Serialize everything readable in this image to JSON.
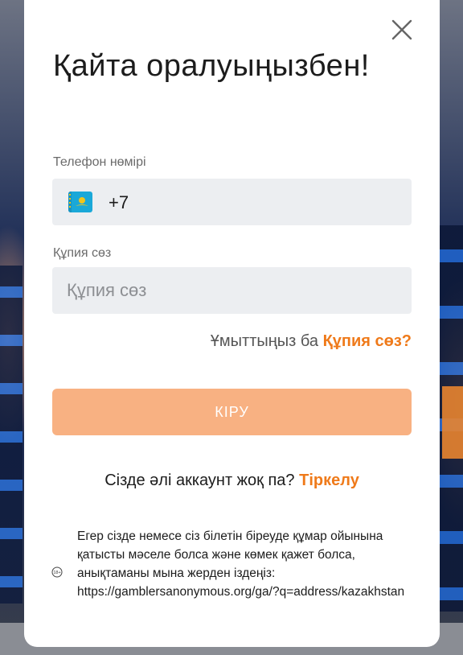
{
  "modal": {
    "title": "Қайта оралуыңызбен!",
    "close_icon": "close-icon"
  },
  "form": {
    "phone_label": "Телефон нөмірі",
    "phone_prefix": "+7",
    "phone_flag": "kazakhstan-flag-icon",
    "password_label": "Құпия сөз",
    "password_placeholder": "Құпия сөз",
    "forgot_text": "Ұмыттыңыз ба",
    "forgot_link": "Құпия сөз?",
    "login_button": "КІРУ"
  },
  "register": {
    "text": "Сізде әлі аккаунт жоқ па?",
    "link": "Тіркелу"
  },
  "help": {
    "icon": "age-18-plus-icon",
    "text": "Егер сізде немесе сіз білетін біреуде құмар ойынына қатысты мәселе болса және көмек қажет болса, анықтаманы мына жерден іздеңіз: https://gamblersanonymous.org/ga/?q=address/kazakhstan"
  },
  "colors": {
    "accent": "#ef7a1a",
    "button_disabled": "#f8b182",
    "field_bg": "#eceef1"
  }
}
